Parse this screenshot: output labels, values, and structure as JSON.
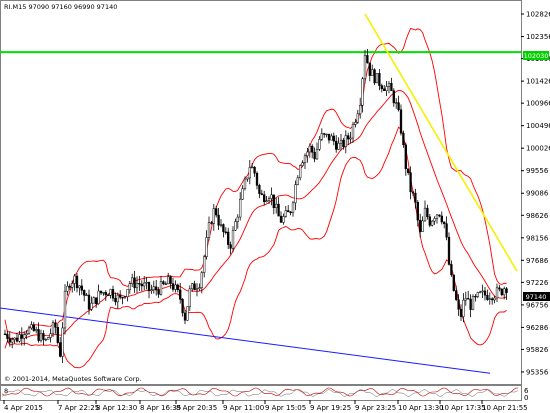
{
  "chart_header": "RI.M15  97090 97160 96990 97140",
  "copyright": "© 2001-2014, MetaQuotes Software Corp.",
  "osc_label": "8",
  "osc_right_top": "6",
  "osc_right_bottom": "0",
  "y_ticks": [
    "102826",
    "102356",
    "101896",
    "101426",
    "100966",
    "100496",
    "100026",
    "99556",
    "99086",
    "98626",
    "98156",
    "97686",
    "97226",
    "96756",
    "96286",
    "95826",
    "95356"
  ],
  "x_ticks": [
    "4 Apr 2015",
    "7 Apr 22:25",
    "8 Apr 12:30",
    "8 Apr 16:35",
    "8 Apr 20:35",
    "9 Apr 11:00",
    "9 Apr 15:05",
    "9 Apr 19:25",
    "9 Apr 23:25",
    "10 Apr 13:30",
    "10 Apr 17:35",
    "10 Apr 21:55"
  ],
  "price_tags": {
    "level": "102030",
    "current": "97140"
  },
  "colors": {
    "candle": "#000000",
    "bands": "#ff0000",
    "hline": "#00e000",
    "trend_yellow": "#f2f200",
    "trend_blue": "#1a1aff",
    "grid": "#c0c0c0",
    "osc": "#c00000"
  },
  "chart_data": {
    "type": "candlestick",
    "symbol": "RI",
    "timeframe": "M15",
    "ylim": [
      95126,
      103056
    ],
    "hline": 102030,
    "current": 97140,
    "trend_yellow": [
      [
        365,
        102826
      ],
      [
        517,
        97460
      ]
    ],
    "trend_blue": [
      [
        0,
        96690
      ],
      [
        490,
        95330
      ]
    ],
    "ohlc_anchor_x": [
      5,
      15,
      25,
      35,
      45,
      55,
      60,
      65,
      70,
      75,
      80,
      90,
      100,
      110,
      120,
      130,
      140,
      150,
      160,
      170,
      180,
      185,
      190,
      200,
      210,
      215,
      220,
      230,
      240,
      250,
      255,
      260,
      270,
      280,
      290,
      300,
      310,
      315,
      320,
      330,
      340,
      350,
      360,
      365,
      370,
      380,
      390,
      395,
      400,
      405,
      410,
      415,
      420,
      425,
      430,
      435,
      440,
      445,
      450,
      455,
      460,
      465,
      470,
      480,
      490,
      500,
      505
    ],
    "ohlc_anchor_close": [
      96150,
      96020,
      96250,
      96200,
      95970,
      96340,
      95700,
      96920,
      97260,
      97300,
      97150,
      96710,
      97000,
      97060,
      96850,
      97220,
      97200,
      97050,
      97100,
      97250,
      96910,
      96500,
      97050,
      97250,
      98480,
      98780,
      98400,
      97980,
      98880,
      99680,
      99500,
      99000,
      99090,
      98510,
      98680,
      99750,
      100030,
      99850,
      100260,
      100250,
      100050,
      100280,
      101010,
      102030,
      101620,
      101390,
      101250,
      101010,
      100590,
      99750,
      99200,
      98900,
      98200,
      98700,
      98500,
      98660,
      98700,
      98400,
      97400,
      96950,
      96450,
      96950,
      96750,
      96950,
      96980,
      97020,
      97140
    ]
  }
}
